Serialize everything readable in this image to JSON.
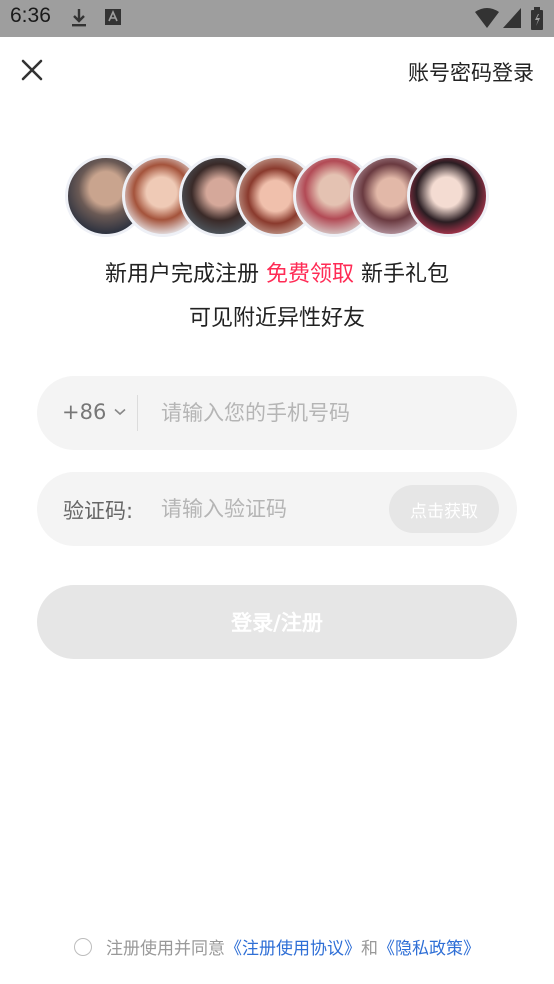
{
  "status_bar": {
    "time": "6:36"
  },
  "header": {
    "close_icon": "close-icon",
    "password_login": "账号密码登录"
  },
  "avatars": [
    "avatar-1",
    "avatar-2",
    "avatar-3",
    "avatar-4",
    "avatar-5",
    "avatar-6",
    "avatar-7"
  ],
  "promo": {
    "line1_prefix": "新用户完成注册 ",
    "line1_highlight": "免费领取",
    "line1_suffix": " 新手礼包",
    "line2": "可见附近异性好友",
    "highlight_color": "#ff2b55"
  },
  "phone": {
    "country_code": "+86",
    "placeholder": "请输入您的手机号码"
  },
  "code": {
    "label": "验证码:",
    "placeholder": "请输入验证码",
    "get_code": "点击获取"
  },
  "submit": {
    "label": "登录/注册"
  },
  "agreement": {
    "prefix": "注册使用并同意",
    "terms": "《注册使用协议》",
    "and": "和",
    "privacy": "《隐私政策》",
    "link_color": "#2f6fd6"
  }
}
